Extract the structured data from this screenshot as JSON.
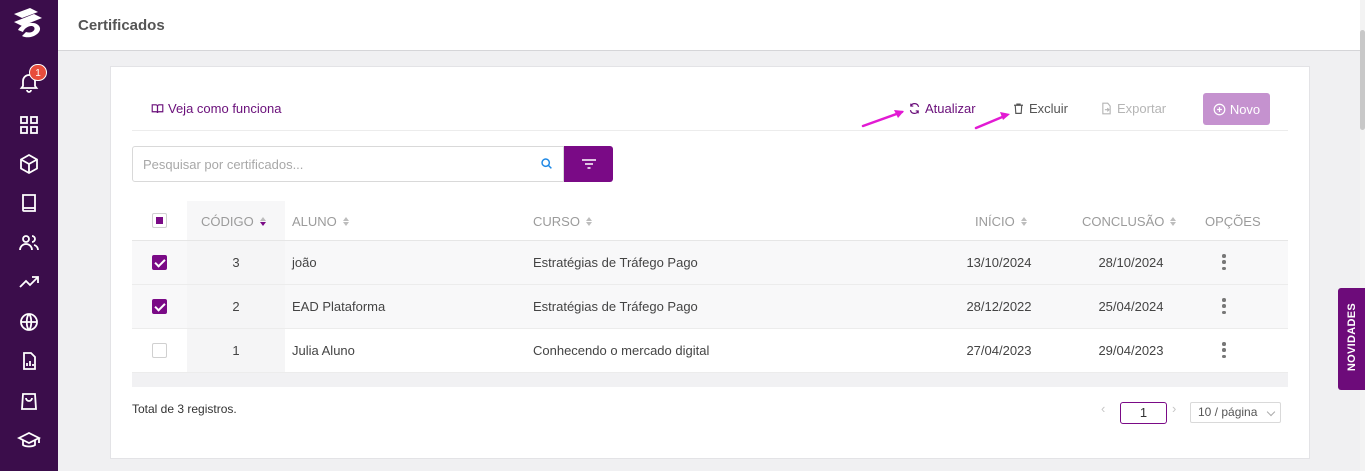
{
  "header": {
    "title": "Certificados"
  },
  "sidebar": {
    "notification_count": "1",
    "icons": [
      "logo-icon",
      "bell-icon",
      "grid-icon",
      "cube-icon",
      "book-icon",
      "users-icon",
      "trending-icon",
      "globe-icon",
      "report-icon",
      "bag-icon",
      "graduation-icon"
    ]
  },
  "toolbar": {
    "how_it_works": "Veja como funciona",
    "refresh": "Atualizar",
    "delete": "Excluir",
    "export": "Exportar",
    "new": "Novo"
  },
  "search": {
    "placeholder": "Pesquisar por certificados..."
  },
  "table": {
    "columns": {
      "code": "CÓDIGO",
      "student": "ALUNO",
      "course": "CURSO",
      "start": "INÍCIO",
      "end": "CONCLUSÃO",
      "options": "OPÇÕES"
    },
    "rows": [
      {
        "selected": true,
        "code": "3",
        "student": "joão",
        "course": "Estratégias de Tráfego Pago",
        "start": "13/10/2024",
        "end": "28/10/2024"
      },
      {
        "selected": true,
        "code": "2",
        "student": "EAD Plataforma",
        "course": "Estratégias de Tráfego Pago",
        "start": "28/12/2022",
        "end": "25/04/2024"
      },
      {
        "selected": false,
        "code": "1",
        "student": "Julia Aluno",
        "course": "Conhecendo o mercado digital",
        "start": "27/04/2023",
        "end": "29/04/2023"
      }
    ]
  },
  "footer": {
    "total": "Total de 3 registros.",
    "current_page": "1",
    "page_size": "10 / página"
  },
  "novidades": "NOVIDADES",
  "colors": {
    "sidebar": "#3b0d4b",
    "accent": "#7a0a86",
    "new_button": "#c592cf",
    "arrow": "#e21ad3"
  }
}
